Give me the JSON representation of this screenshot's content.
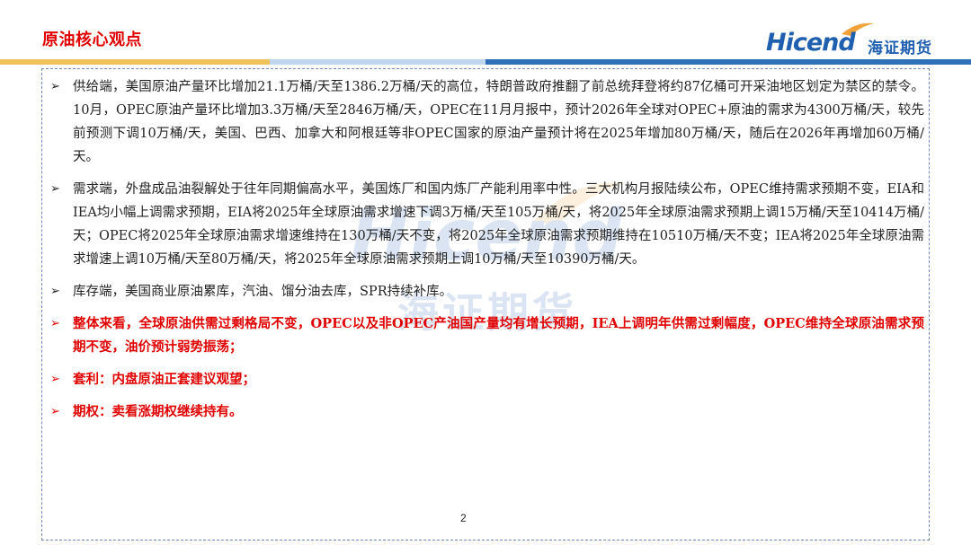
{
  "header": {
    "title": "原油核心观点",
    "logo_en": "Hicend",
    "logo_cn": "海证期货"
  },
  "colors": {
    "title_red": "#e00000",
    "brand_blue": "#1f5fb0",
    "bar_gold": "#f1c15c",
    "bar_light_blue": "#bfd7ee",
    "bar_blue": "#2f6fb8"
  },
  "watermark": {
    "en": "Hicend",
    "cn": "海证期货"
  },
  "bullets": [
    {
      "text": "供给端，美国原油产量环比增加21.1万桶/天至1386.2万桶/天的高位，特朗普政府推翻了前总统拜登将约87亿桶可开采油地区划定为禁区的禁令。10月，OPEC原油产量环比增加3.3万桶/天至2846万桶/天，OPEC在11月月报中，预计2026年全球对OPEC+原油的需求为4300万桶/天，较先前预测下调10万桶/天，美国、巴西、加拿大和阿根廷等非OPEC国家的原油产量预计将在2025年增加80万桶/天，随后在2026年再增加60万桶/天。",
      "highlight": false
    },
    {
      "text": "需求端，外盘成品油裂解处于往年同期偏高水平，美国炼厂和国内炼厂产能利用率中性。三大机构月报陆续公布，OPEC维持需求预期不变，EIA和IEA均小幅上调需求预期，EIA将2025年全球原油需求增速下调3万桶/天至105万桶/天，将2025年全球原油需求预期上调15万桶/天至10414万桶/天；OPEC将2025年全球原油需求增速维持在130万桶/天不变，将2025年全球原油需求预期维持在10510万桶/天不变；IEA将2025年全球原油需求增速上调10万桶/天至80万桶/天，将2025年全球原油需求预期上调10万桶/天至10390万桶/天。",
      "highlight": false
    },
    {
      "text": "库存端，美国商业原油累库，汽油、馏分油去库，SPR持续补库。",
      "highlight": false
    },
    {
      "text": "整体来看，全球原油供需过剩格局不变，OPEC以及非OPEC产油国产量均有增长预期，IEA上调明年供需过剩幅度，OPEC维持全球原油需求预期不变，油价预计弱势振荡；",
      "highlight": true
    },
    {
      "text": "套利：内盘原油正套建议观望；",
      "highlight": true
    },
    {
      "text": "期权：卖看涨期权继续持有。",
      "highlight": true
    }
  ],
  "footer": {
    "page_number": "2"
  }
}
